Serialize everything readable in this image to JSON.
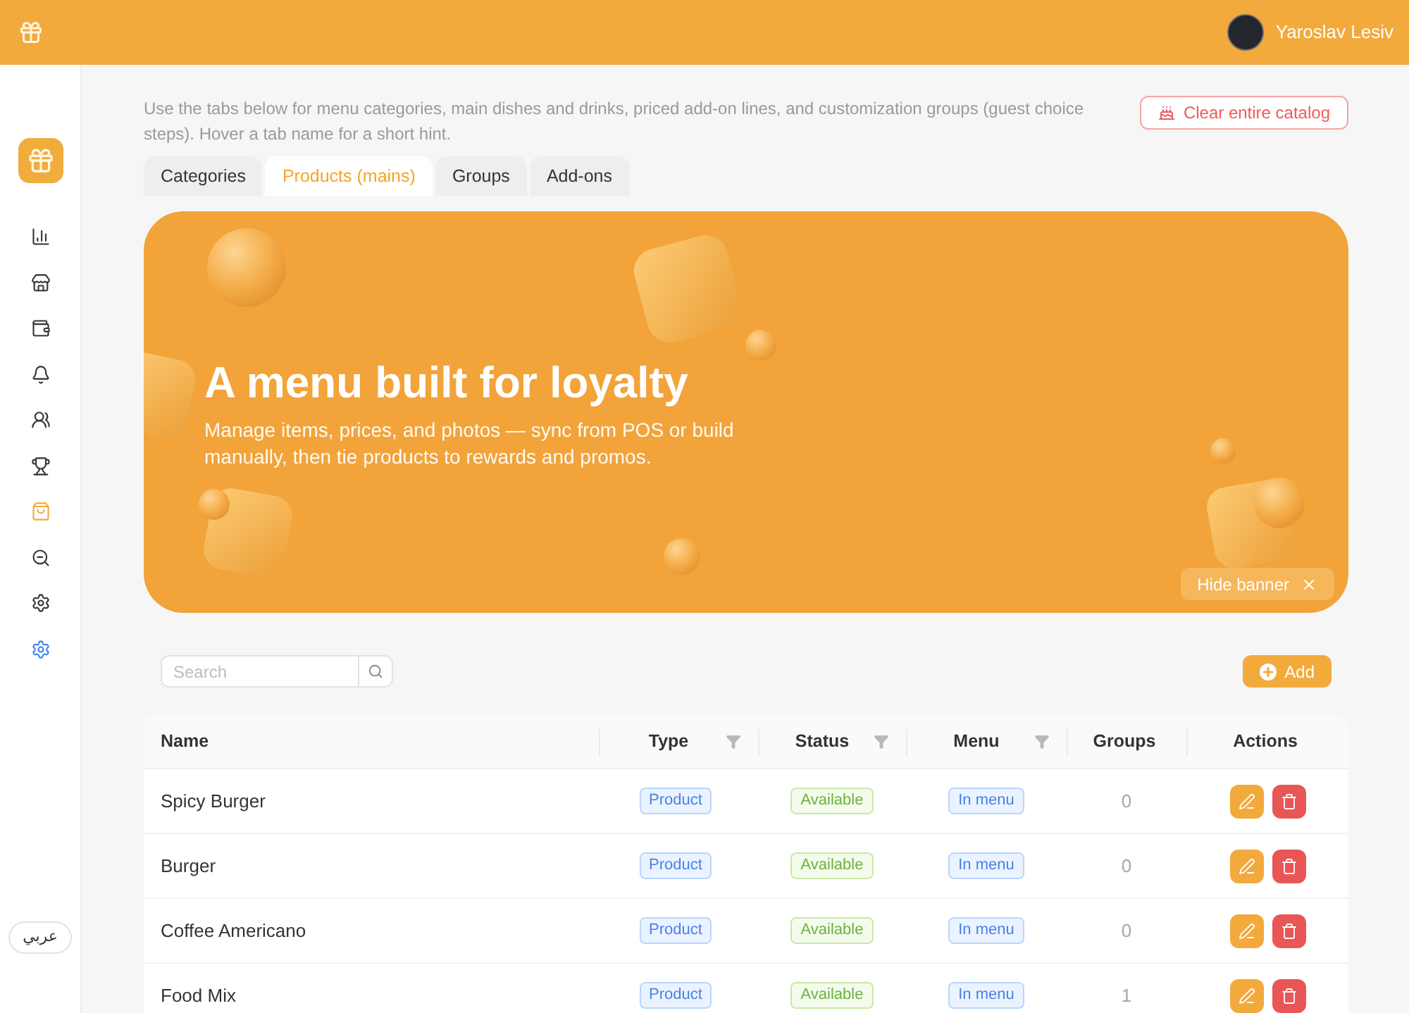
{
  "top_bar": {
    "user_name": "Yaroslav Lesiv"
  },
  "sidebar": {
    "items": [
      {
        "selected": false,
        "hovered": false
      },
      {
        "selected": false,
        "hovered": false
      },
      {
        "selected": false,
        "hovered": false
      },
      {
        "selected": false,
        "hovered": false
      },
      {
        "selected": false,
        "hovered": false
      },
      {
        "selected": false,
        "hovered": false
      },
      {
        "selected": true,
        "hovered": false
      },
      {
        "selected": false,
        "hovered": false
      },
      {
        "selected": false,
        "hovered": false
      },
      {
        "selected": false,
        "hovered": true
      }
    ],
    "language_button": "عربي"
  },
  "header": {
    "description": "Use the tabs below for menu categories, main dishes and drinks, priced add-on lines, and customization groups (guest choice steps). Hover a tab name for a short hint.",
    "clear_button": "Clear entire catalog"
  },
  "tabs": [
    {
      "label": "Categories",
      "selected": false
    },
    {
      "label": "Products (mains)",
      "selected": true
    },
    {
      "label": "Groups",
      "selected": false
    },
    {
      "label": "Add-ons",
      "selected": false
    }
  ],
  "banner": {
    "title": "A menu built for loyalty",
    "subtitle": "Manage items, prices, and photos — sync from POS or build manually, then tie products to rewards and promos.",
    "hide_button": "Hide banner"
  },
  "toolbar": {
    "search": {
      "placeholder": "Search"
    },
    "add_button": "Add"
  },
  "table": {
    "columns": [
      {
        "label": "Name",
        "filter": false
      },
      {
        "label": "Type",
        "filter": true
      },
      {
        "label": "Status",
        "filter": true
      },
      {
        "label": "Menu",
        "filter": true
      },
      {
        "label": "Groups",
        "filter": false
      },
      {
        "label": "Actions",
        "filter": false
      }
    ],
    "rows": [
      {
        "name": "Spicy Burger",
        "type": "Product",
        "status": "Available",
        "menu": "In menu",
        "groups": "0"
      },
      {
        "name": "Burger",
        "type": "Product",
        "status": "Available",
        "menu": "In menu",
        "groups": "0"
      },
      {
        "name": "Coffee Americano",
        "type": "Product",
        "status": "Available",
        "menu": "In menu",
        "groups": "0"
      },
      {
        "name": "Food Mix",
        "type": "Product",
        "status": "Available",
        "menu": "In menu",
        "groups": "1"
      }
    ]
  }
}
